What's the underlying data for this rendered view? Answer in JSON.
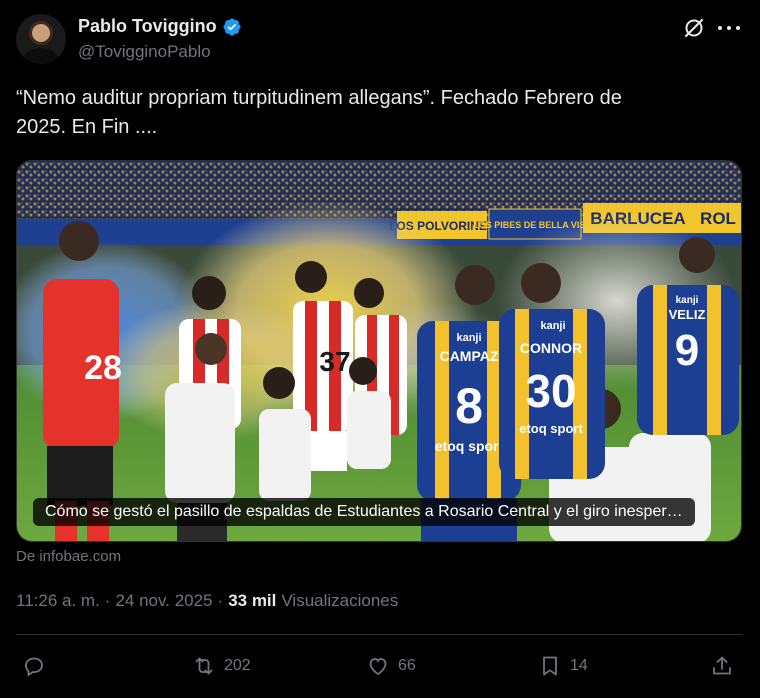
{
  "author": {
    "display_name": "Pablo Toviggino",
    "handle": "@TovigginoPablo",
    "verified": true
  },
  "tweet": {
    "text_line1": "“Nemo auditur propriam turpitudinem allegans”. Fechado Febrero de",
    "text_line2": "2025. En Fin ...."
  },
  "link_card": {
    "caption": "Cómo se gestó el pasillo de espaldas de Estudiantes a Rosario Central y el giro inesper…",
    "source": "De infobae.com",
    "banner_texts": [
      "LOS POLVORINES",
      "LOS PIBES DE BELLA VISTA",
      "BARLUCEA",
      "ROL"
    ],
    "players": [
      {
        "shirt_name": "CAMPAZ",
        "number": "8"
      },
      {
        "shirt_name": "CONNOR",
        "number": "30"
      },
      {
        "shirt_name": "VELIZ",
        "number": "9"
      },
      {
        "shirt_name": "",
        "number": "28"
      },
      {
        "shirt_name": "",
        "number": "37"
      }
    ],
    "sponsor": "etoq sport",
    "brand": "kanji"
  },
  "meta": {
    "time": "11:26 a. m.",
    "separator": "·",
    "date": "24 nov. 2025",
    "views_count": "33 mil",
    "views_label": "Visualizaciones"
  },
  "actions": {
    "reply_count": "",
    "retweet_count": "202",
    "like_count": "66",
    "bookmark_count": "14"
  },
  "colors": {
    "background": "#000000",
    "text": "#e7e9ea",
    "muted": "#71767b",
    "verified": "#1d9bf0",
    "divider": "#2f3336"
  }
}
